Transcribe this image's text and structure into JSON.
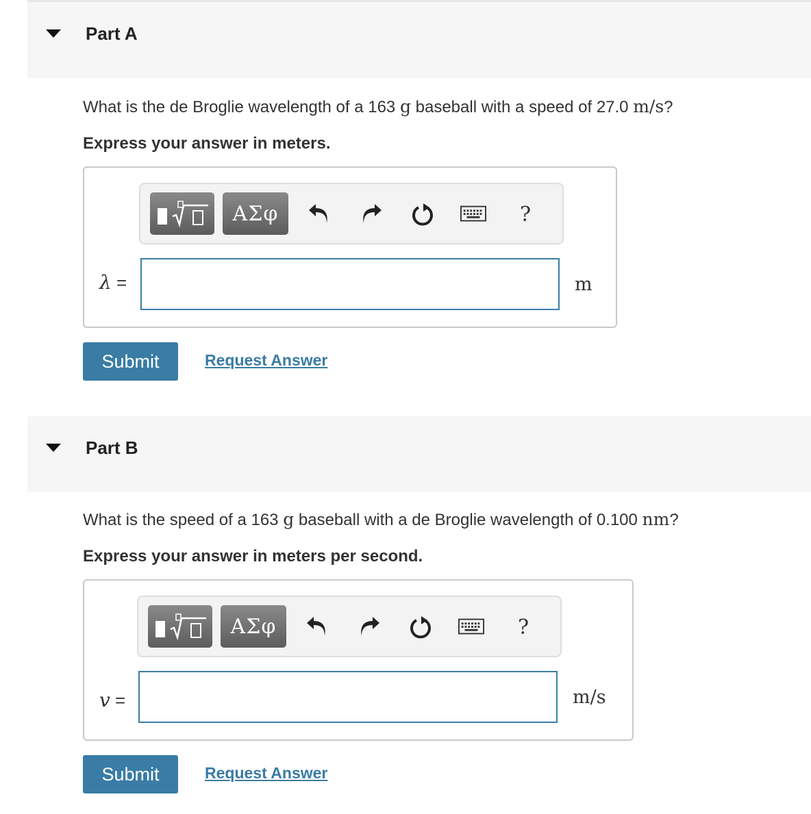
{
  "part_a": {
    "title": "Part A",
    "question_prefix": "What is the de Broglie wavelength of a 163 ",
    "question_mass_unit": "g",
    "question_middle": " baseball with a speed of 27.0 ",
    "question_speed_unit": "m/s",
    "question_suffix": "?",
    "instruction": "Express your answer in meters.",
    "variable_symbol": "λ",
    "variable_equals": " =",
    "input_value": "",
    "unit": "m",
    "submit_label": "Submit",
    "request_label": "Request Answer"
  },
  "part_b": {
    "title": "Part B",
    "question_prefix": "What is the speed of a 163 ",
    "question_mass_unit": "g",
    "question_middle": " baseball with a de Broglie wavelength of 0.100 ",
    "question_length_unit": "nm",
    "question_suffix": "?",
    "instruction": "Express your answer in meters per second.",
    "variable_symbol": "v",
    "variable_equals": " =",
    "input_value": "",
    "unit": "m/s",
    "submit_label": "Submit",
    "request_label": "Request Answer"
  },
  "toolbar": {
    "greek_label": "ΑΣφ",
    "help_label": "?",
    "icons": [
      "templates-icon",
      "greek-letters-icon",
      "undo-icon",
      "redo-icon",
      "reset-icon",
      "keyboard-icon",
      "help-icon"
    ]
  },
  "colors": {
    "accent": "#3a7ca5",
    "header_bg": "#f6f6f6",
    "toolbar_button": "#6f6f6f"
  }
}
